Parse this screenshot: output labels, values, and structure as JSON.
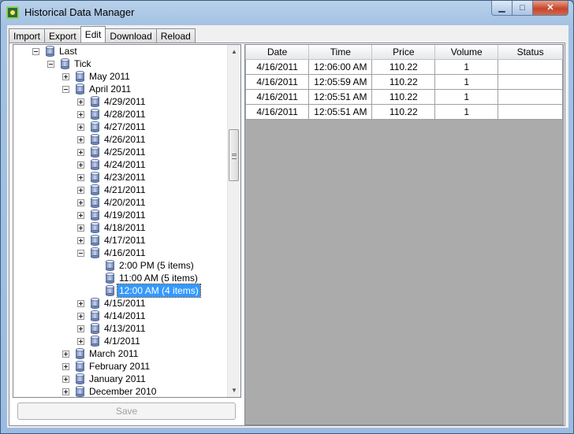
{
  "window": {
    "title": "Historical Data Manager",
    "icon": "app-icon",
    "controls": {
      "minimize": "▁",
      "maximize": "□",
      "close": "✕"
    }
  },
  "tabs": [
    {
      "label": "Import",
      "active": false
    },
    {
      "label": "Export",
      "active": false
    },
    {
      "label": "Edit",
      "active": true
    },
    {
      "label": "Download",
      "active": false
    },
    {
      "label": "Reload",
      "active": false
    }
  ],
  "tree": {
    "items": [
      {
        "label": "Last",
        "level": 0,
        "expander": "minus"
      },
      {
        "label": "Tick",
        "level": 1,
        "expander": "minus"
      },
      {
        "label": "May 2011",
        "level": 2,
        "expander": "plus"
      },
      {
        "label": "April 2011",
        "level": 2,
        "expander": "minus"
      },
      {
        "label": "4/29/2011",
        "level": 3,
        "expander": "plus"
      },
      {
        "label": "4/28/2011",
        "level": 3,
        "expander": "plus"
      },
      {
        "label": "4/27/2011",
        "level": 3,
        "expander": "plus"
      },
      {
        "label": "4/26/2011",
        "level": 3,
        "expander": "plus"
      },
      {
        "label": "4/25/2011",
        "level": 3,
        "expander": "plus"
      },
      {
        "label": "4/24/2011",
        "level": 3,
        "expander": "plus"
      },
      {
        "label": "4/23/2011",
        "level": 3,
        "expander": "plus"
      },
      {
        "label": "4/21/2011",
        "level": 3,
        "expander": "plus"
      },
      {
        "label": "4/20/2011",
        "level": 3,
        "expander": "plus"
      },
      {
        "label": "4/19/2011",
        "level": 3,
        "expander": "plus"
      },
      {
        "label": "4/18/2011",
        "level": 3,
        "expander": "plus"
      },
      {
        "label": "4/17/2011",
        "level": 3,
        "expander": "plus"
      },
      {
        "label": "4/16/2011",
        "level": 3,
        "expander": "minus"
      },
      {
        "label": "2:00 PM (5 items)",
        "level": 4,
        "expander": "none"
      },
      {
        "label": "11:00 AM (5 items)",
        "level": 4,
        "expander": "none"
      },
      {
        "label": "12:00 AM (4 items)",
        "level": 4,
        "expander": "none",
        "selected": true
      },
      {
        "label": "4/15/2011",
        "level": 3,
        "expander": "plus"
      },
      {
        "label": "4/14/2011",
        "level": 3,
        "expander": "plus"
      },
      {
        "label": "4/13/2011",
        "level": 3,
        "expander": "plus"
      },
      {
        "label": "4/1/2011",
        "level": 3,
        "expander": "plus"
      },
      {
        "label": "March 2011",
        "level": 2,
        "expander": "plus"
      },
      {
        "label": "February 2011",
        "level": 2,
        "expander": "plus"
      },
      {
        "label": "January 2011",
        "level": 2,
        "expander": "plus"
      },
      {
        "label": "December 2010",
        "level": 2,
        "expander": "plus"
      }
    ],
    "scroll_up": "▲",
    "scroll_down": "▼"
  },
  "save_label": "Save",
  "table": {
    "columns": [
      "Date",
      "Time",
      "Price",
      "Volume",
      "Status"
    ],
    "rows": [
      [
        "4/16/2011",
        "12:06:00 AM",
        "110.22",
        "1",
        ""
      ],
      [
        "4/16/2011",
        "12:05:59 AM",
        "110.22",
        "1",
        ""
      ],
      [
        "4/16/2011",
        "12:05:51 AM",
        "110.22",
        "1",
        ""
      ],
      [
        "4/16/2011",
        "12:05:51 AM",
        "110.22",
        "1",
        ""
      ]
    ]
  },
  "colors": {
    "selection": "#3399ff",
    "grid_background": "#ababab",
    "close_button": "#c7452b"
  }
}
